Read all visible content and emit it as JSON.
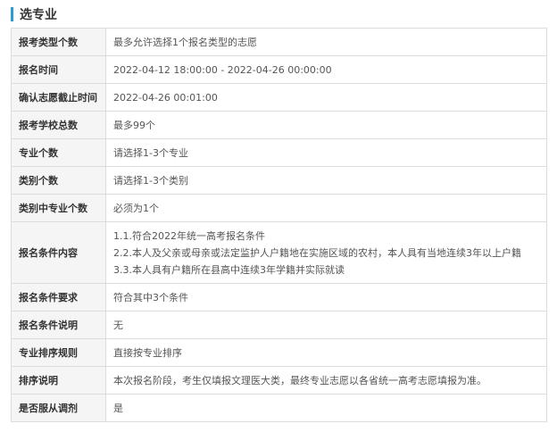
{
  "section": {
    "title": "选专业"
  },
  "rows": [
    {
      "label": "报考类型个数",
      "value": "最多允许选择1个报名类型的志愿"
    },
    {
      "label": "报名时间",
      "value": "2022-04-12 18:00:00 - 2022-04-26 00:00:00"
    },
    {
      "label": "确认志愿截止时间",
      "value": "2022-04-26 00:01:00"
    },
    {
      "label": "报考学校总数",
      "value": "最多99个"
    },
    {
      "label": "专业个数",
      "value": "请选择1-3个专业"
    },
    {
      "label": "类别个数",
      "value": "请选择1-3个类别"
    },
    {
      "label": "类别中专业个数",
      "value": "必须为1个"
    },
    {
      "label": "报名条件内容",
      "lines": [
        "1.1.符合2022年统一高考报名条件",
        "2.2.本人及父亲或母亲或法定监护人户籍地在实施区域的农村，本人具有当地连续3年以上户籍",
        "3.3.本人具有户籍所在县高中连续3年学籍并实际就读"
      ]
    },
    {
      "label": "报名条件要求",
      "value": "符合其中3个条件"
    },
    {
      "label": "报名条件说明",
      "value": "无"
    },
    {
      "label": "专业排序规则",
      "value": "直接按专业排序"
    },
    {
      "label": "排序说明",
      "value": "本次报名阶段，考生仅填报文理医大类，最终专业志愿以各省统一高考志愿填报为准。"
    },
    {
      "label": "是否服从调剂",
      "value": "是"
    }
  ]
}
